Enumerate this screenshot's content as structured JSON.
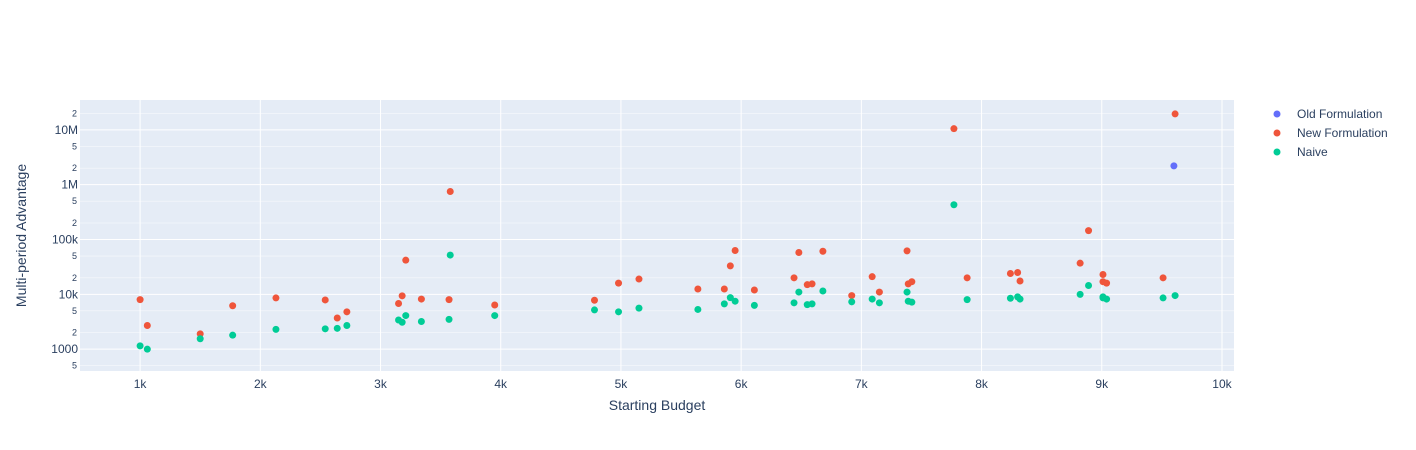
{
  "chart_data": {
    "type": "scatter",
    "title": "",
    "xlabel": "Starting Budget",
    "ylabel": "Multi-period Advantage",
    "x_axis": {
      "scale": "linear",
      "range": [
        500,
        10100
      ],
      "ticks": [
        1000,
        2000,
        3000,
        4000,
        5000,
        6000,
        7000,
        8000,
        9000,
        10000
      ],
      "tick_labels": [
        "1k",
        "2k",
        "3k",
        "4k",
        "5k",
        "6k",
        "7k",
        "8k",
        "9k",
        "10k"
      ]
    },
    "y_axis": {
      "scale": "log",
      "range": [
        400,
        35000000
      ],
      "major_ticks": [
        1000,
        10000,
        100000,
        1000000,
        10000000
      ],
      "major_labels": [
        "1000",
        "10k",
        "100k",
        "1M",
        "10M"
      ],
      "minor_ticks": [
        500,
        2000,
        5000,
        20000,
        50000,
        200000,
        500000,
        2000000,
        5000000,
        20000000
      ],
      "minor_labels": [
        "5",
        "2",
        "5",
        "2",
        "5",
        "2",
        "5",
        "2",
        "5",
        "2"
      ]
    },
    "grid": true,
    "legend_position": "top-right",
    "series": [
      {
        "name": "Old Formulation",
        "color": "#636efa",
        "points": [
          [
            9600,
            2200000
          ]
        ]
      },
      {
        "name": "New Formulation",
        "color": "#ef553b",
        "points": [
          [
            1000,
            8000
          ],
          [
            1060,
            2700
          ],
          [
            1500,
            1900
          ],
          [
            1770,
            6200
          ],
          [
            2130,
            8600
          ],
          [
            2540,
            7900
          ],
          [
            2640,
            3700
          ],
          [
            2720,
            4800
          ],
          [
            3150,
            6800
          ],
          [
            3180,
            9400
          ],
          [
            3210,
            42000
          ],
          [
            3340,
            8200
          ],
          [
            3570,
            8000
          ],
          [
            3580,
            750000
          ],
          [
            3950,
            6400
          ],
          [
            4780,
            7800
          ],
          [
            4980,
            16000
          ],
          [
            5150,
            19000
          ],
          [
            5640,
            12500
          ],
          [
            5860,
            12500
          ],
          [
            5910,
            33000
          ],
          [
            5950,
            63000
          ],
          [
            6110,
            12000
          ],
          [
            6440,
            20000
          ],
          [
            6480,
            58000
          ],
          [
            6550,
            15000
          ],
          [
            6590,
            15500
          ],
          [
            6680,
            61000
          ],
          [
            6920,
            9500
          ],
          [
            7090,
            21000
          ],
          [
            7150,
            11000
          ],
          [
            7380,
            62000
          ],
          [
            7390,
            15500
          ],
          [
            7420,
            17000
          ],
          [
            7770,
            10500000
          ],
          [
            7880,
            20000
          ],
          [
            8240,
            24000
          ],
          [
            8300,
            25000
          ],
          [
            8320,
            17500
          ],
          [
            8820,
            37000
          ],
          [
            8890,
            145000
          ],
          [
            9010,
            23000
          ],
          [
            9010,
            17000
          ],
          [
            9040,
            16000
          ],
          [
            9510,
            20000
          ],
          [
            9610,
            19500000
          ]
        ]
      },
      {
        "name": "Naive",
        "color": "#00cc96",
        "points": [
          [
            1000,
            1150
          ],
          [
            1060,
            1000
          ],
          [
            1500,
            1550
          ],
          [
            1770,
            1800
          ],
          [
            2130,
            2300
          ],
          [
            2540,
            2350
          ],
          [
            2640,
            2400
          ],
          [
            2720,
            2700
          ],
          [
            3150,
            3400
          ],
          [
            3180,
            3100
          ],
          [
            3210,
            4100
          ],
          [
            3340,
            3200
          ],
          [
            3570,
            3500
          ],
          [
            3580,
            52000
          ],
          [
            3950,
            4100
          ],
          [
            4780,
            5200
          ],
          [
            4980,
            4800
          ],
          [
            5150,
            5600
          ],
          [
            5640,
            5300
          ],
          [
            5860,
            6700
          ],
          [
            5910,
            8700
          ],
          [
            5950,
            7500
          ],
          [
            6110,
            6300
          ],
          [
            6440,
            7000
          ],
          [
            6480,
            11000
          ],
          [
            6550,
            6500
          ],
          [
            6590,
            6700
          ],
          [
            6680,
            11500
          ],
          [
            6920,
            7300
          ],
          [
            7090,
            8200
          ],
          [
            7150,
            7000
          ],
          [
            7380,
            11000
          ],
          [
            7390,
            7500
          ],
          [
            7420,
            7200
          ],
          [
            7770,
            430000
          ],
          [
            7880,
            8000
          ],
          [
            8240,
            8500
          ],
          [
            8300,
            9000
          ],
          [
            8320,
            8200
          ],
          [
            8820,
            10000
          ],
          [
            8890,
            14500
          ],
          [
            9010,
            9000
          ],
          [
            9010,
            8600
          ],
          [
            9040,
            8200
          ],
          [
            9510,
            8600
          ],
          [
            9610,
            9500
          ]
        ]
      }
    ]
  }
}
